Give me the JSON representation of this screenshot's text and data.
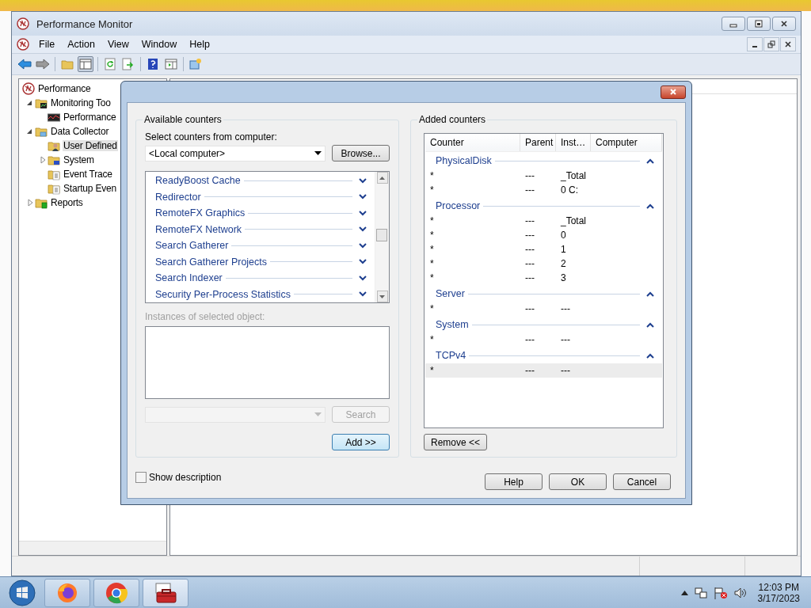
{
  "window": {
    "title": "Performance Monitor"
  },
  "menu": [
    "File",
    "Action",
    "View",
    "Window",
    "Help"
  ],
  "tree": [
    {
      "label": "Performance",
      "kind": "perf",
      "selected": false,
      "children": [
        {
          "label": "Monitoring Too",
          "kind": "tools",
          "expanded": true,
          "selected": false,
          "children": [
            {
              "label": "Performance",
              "kind": "monitor",
              "selected": false
            }
          ]
        },
        {
          "label": "Data Collector",
          "kind": "collector",
          "expanded": true,
          "selected": false,
          "children": [
            {
              "label": "User Defined",
              "kind": "user",
              "selected": true
            },
            {
              "label": "System",
              "kind": "system",
              "expanded": false,
              "selected": false
            },
            {
              "label": "Event Trace",
              "kind": "trace",
              "selected": false
            },
            {
              "label": "Startup Even",
              "kind": "trace",
              "selected": false
            }
          ]
        },
        {
          "label": "Reports",
          "kind": "reports",
          "expanded": false,
          "selected": false
        }
      ]
    }
  ],
  "dialog": {
    "available_label": "Available counters",
    "computer_label": "Select counters from computer:",
    "computer": "<Local computer>",
    "browse": "Browse...",
    "objects": [
      "ReadyBoost Cache",
      "Redirector",
      "RemoteFX Graphics",
      "RemoteFX Network",
      "Search Gatherer",
      "Search Gatherer Projects",
      "Search Indexer",
      "Security Per-Process Statistics"
    ],
    "instances": {
      "label": "Instances of selected object:",
      "disabled": true
    },
    "search_button": {
      "label": "Search",
      "disabled": true
    },
    "add": "Add >>",
    "show_description": {
      "label": "Show description",
      "checked": false
    },
    "added_label": "Added counters",
    "columns": [
      "Counter",
      "Parent",
      "Inst…",
      "Computer"
    ],
    "groups": [
      {
        "name": "PhysicalDisk",
        "rows": [
          {
            "counter": "*",
            "parent": "---",
            "instance": "_Total",
            "selected": false
          },
          {
            "counter": "*",
            "parent": "---",
            "instance": "0 C:",
            "selected": false
          }
        ]
      },
      {
        "name": "Processor",
        "rows": [
          {
            "counter": "*",
            "parent": "---",
            "instance": "_Total",
            "selected": false
          },
          {
            "counter": "*",
            "parent": "---",
            "instance": "0",
            "selected": false
          },
          {
            "counter": "*",
            "parent": "---",
            "instance": "1",
            "selected": false
          },
          {
            "counter": "*",
            "parent": "---",
            "instance": "2",
            "selected": false
          },
          {
            "counter": "*",
            "parent": "---",
            "instance": "3",
            "selected": false
          }
        ]
      },
      {
        "name": "Server",
        "rows": [
          {
            "counter": "*",
            "parent": "---",
            "instance": "---",
            "selected": false
          }
        ]
      },
      {
        "name": "System",
        "rows": [
          {
            "counter": "*",
            "parent": "---",
            "instance": "---",
            "selected": false
          }
        ]
      },
      {
        "name": "TCPv4",
        "rows": [
          {
            "counter": "*",
            "parent": "---",
            "instance": "---",
            "selected": true
          }
        ]
      }
    ],
    "remove": "Remove <<",
    "buttons": [
      "Help",
      "OK",
      "Cancel"
    ]
  },
  "tray": {
    "time": "12:03 PM",
    "date": "3/17/2023"
  }
}
